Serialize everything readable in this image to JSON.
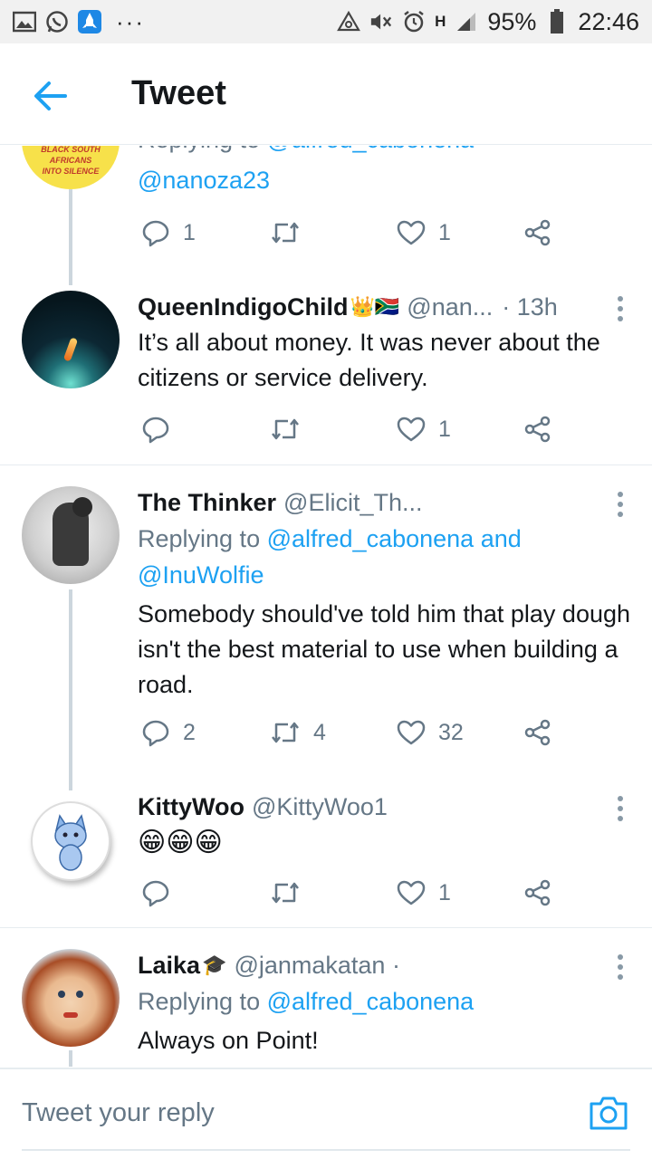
{
  "status_bar": {
    "battery": "95%",
    "time": "22:46",
    "network": "H",
    "overflow": "···"
  },
  "header": {
    "title": "Tweet"
  },
  "tweets": [
    {
      "reply_to_prefix": "Replying to",
      "reply_to_partial": "@alfred_cabonena",
      "mention_line": "@nanoza23",
      "avatar_text_1": "BLACK SOUTH AFRICANS",
      "avatar_text_2": "INTO SILENCE",
      "replies": "1",
      "retweets": "",
      "likes": "1"
    },
    {
      "name": "QueenIndigoChild",
      "name_emoji": "👑🇿🇦",
      "handle": "@nan...",
      "time": "· 13h",
      "text": "It’s all about money. It was never about the citizens or service delivery.",
      "replies": "",
      "retweets": "",
      "likes": "1"
    },
    {
      "name": "The Thinker",
      "handle": "@Elicit_Th...",
      "reply_to_prefix": "Replying to",
      "reply_to_user1": "@alfred_cabonena",
      "reply_to_and": "and",
      "reply_to_user2": "@InuWolfie",
      "text": "Somebody should've told him that play dough isn't the best material to use when building a road.",
      "replies": "2",
      "retweets": "4",
      "likes": "32"
    },
    {
      "name": "KittyWoo",
      "handle": "@KittyWoo1",
      "text": "😁😁😁",
      "replies": "",
      "retweets": "",
      "likes": "1"
    },
    {
      "name": "Laika",
      "name_emoji": "🎓",
      "handle": "@janmakatan ·",
      "reply_to_prefix": "Replying to",
      "reply_to_user1": "@alfred_cabonena",
      "text": "Always on Point!"
    }
  ],
  "reply_bar": {
    "placeholder": "Tweet your reply"
  },
  "colors": {
    "accent": "#1da1f2",
    "secondary_text": "#657786",
    "divider": "#e6ecf0"
  }
}
